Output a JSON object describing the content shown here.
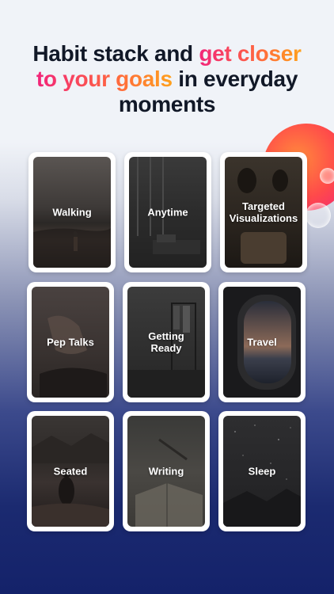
{
  "headline": {
    "line1_plain": "Habit stack and ",
    "line1_accent": "get closer",
    "line2_accent": "to your goals",
    "line2_plain": " in everyday",
    "line3_plain": "moments"
  },
  "cards": [
    {
      "label": "Walking",
      "photo": "beach-walk-photo"
    },
    {
      "label": "Anytime",
      "photo": "interior-room-photo"
    },
    {
      "label": "Targeted\nVisualizations",
      "photo": "private-jet-photo"
    },
    {
      "label": "Pep Talks",
      "photo": "hand-on-chest-photo"
    },
    {
      "label": "Getting\nReady",
      "photo": "closet-photo"
    },
    {
      "label": "Travel",
      "photo": "airplane-window-photo"
    },
    {
      "label": "Seated",
      "photo": "seated-mountain-photo"
    },
    {
      "label": "Writing",
      "photo": "journal-writing-photo"
    },
    {
      "label": "Sleep",
      "photo": "starry-night-photo"
    }
  ],
  "colors": {
    "accent_start": "#f2247a",
    "accent_end": "#ffa11c",
    "background_bottom": "#14226a"
  }
}
